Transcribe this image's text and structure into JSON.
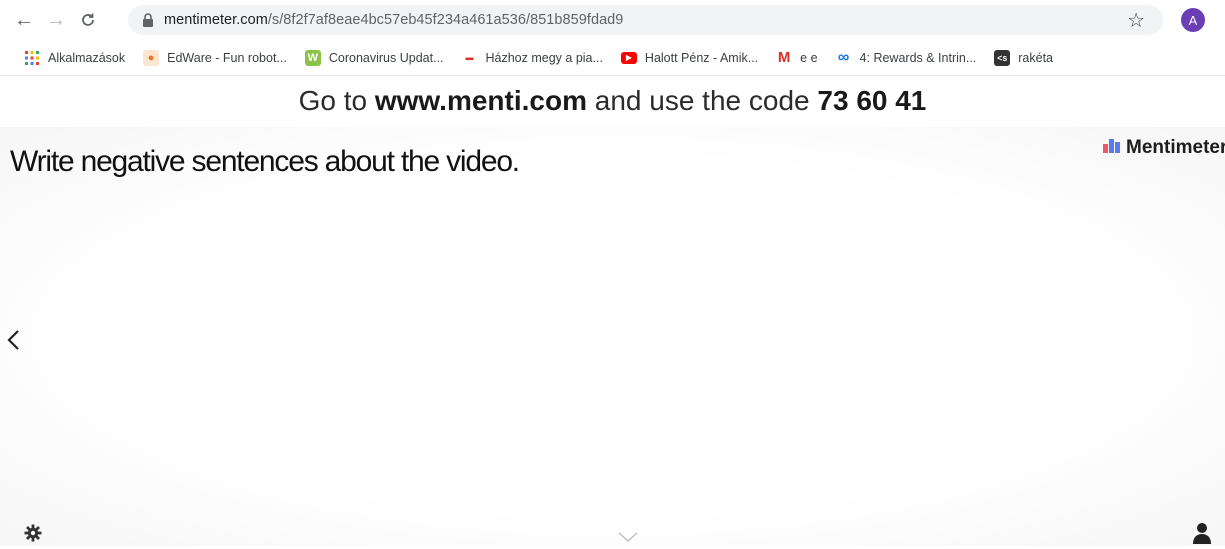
{
  "browser": {
    "url_host": "mentimeter.com",
    "url_path": "/s/8f2f7af8eae4bc57eb45f234a461a536/851b859fdad9",
    "avatar_letter": "A"
  },
  "bookmarks": [
    {
      "label": "Alkalmazások",
      "icon": "apps-grid-icon",
      "color": "#e94235"
    },
    {
      "label": "EdWare - Fun robot...",
      "icon": "edware-icon",
      "color": "#e8a15b"
    },
    {
      "label": "Coronavirus Updat...",
      "icon": "coronavirus-icon",
      "color": "#7cb342"
    },
    {
      "label": "Házhoz megy a pia...",
      "icon": "site-icon",
      "color": "#d93025"
    },
    {
      "label": "Halott Pénz - Amik...",
      "icon": "youtube-icon",
      "color": "#ff0000"
    },
    {
      "label": "e e",
      "icon": "gmail-icon",
      "color": "#d93025"
    },
    {
      "label": "4: Rewards & Intrin...",
      "icon": "infinity-icon",
      "color": "#1a73e8"
    },
    {
      "label": "rakéta",
      "icon": "code-icon",
      "color": "#333333"
    }
  ],
  "join": {
    "prefix": "Go to",
    "site": "www.menti.com",
    "middle": "and use the code",
    "code": "73 60 41"
  },
  "slide": {
    "title": "Write negative sentences about the video.",
    "brand": "Mentimeter"
  }
}
